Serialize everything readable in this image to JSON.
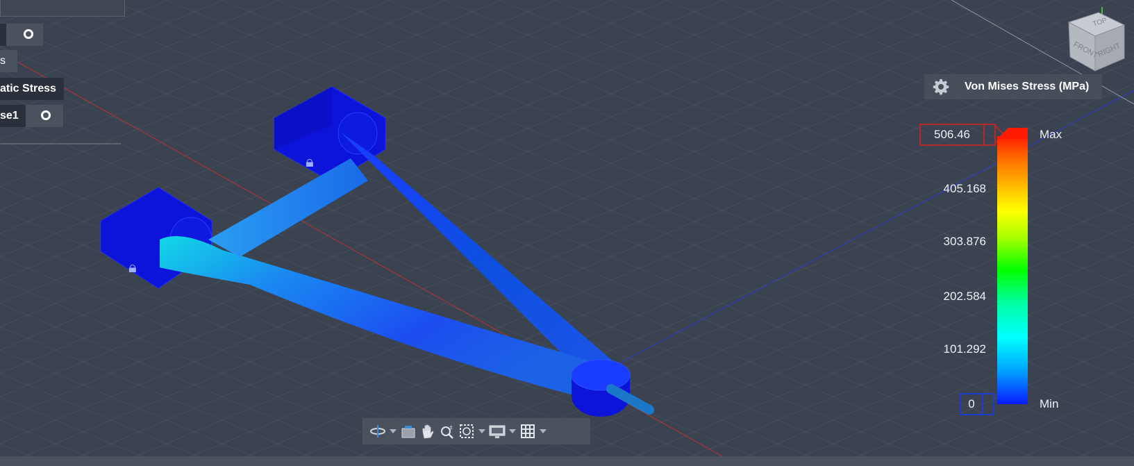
{
  "browser": {
    "row1_label": "",
    "row2_label": "s",
    "row3_label": "atic Stress",
    "row4_label": "se1"
  },
  "legend": {
    "title": "Von Mises Stress (MPa)",
    "max_value": "506.46",
    "min_value": "0",
    "max_label": "Max",
    "min_label": "Min",
    "ticks": [
      "405.168",
      "303.876",
      "202.584",
      "101.292"
    ],
    "colors": {
      "max": "#ff1a00",
      "min": "#0a1aff",
      "max_box_border": "#b22a2a",
      "min_box_border": "#1f3bd0"
    }
  },
  "viewcube": {
    "top": "TOP",
    "front": "FRONT",
    "right": "RIGHT"
  },
  "navbar": {
    "tools": [
      "orbit-icon",
      "look-at-icon",
      "pan-icon",
      "zoom-icon",
      "zoom-window-icon",
      "display-settings-icon",
      "grid-settings-icon"
    ]
  }
}
